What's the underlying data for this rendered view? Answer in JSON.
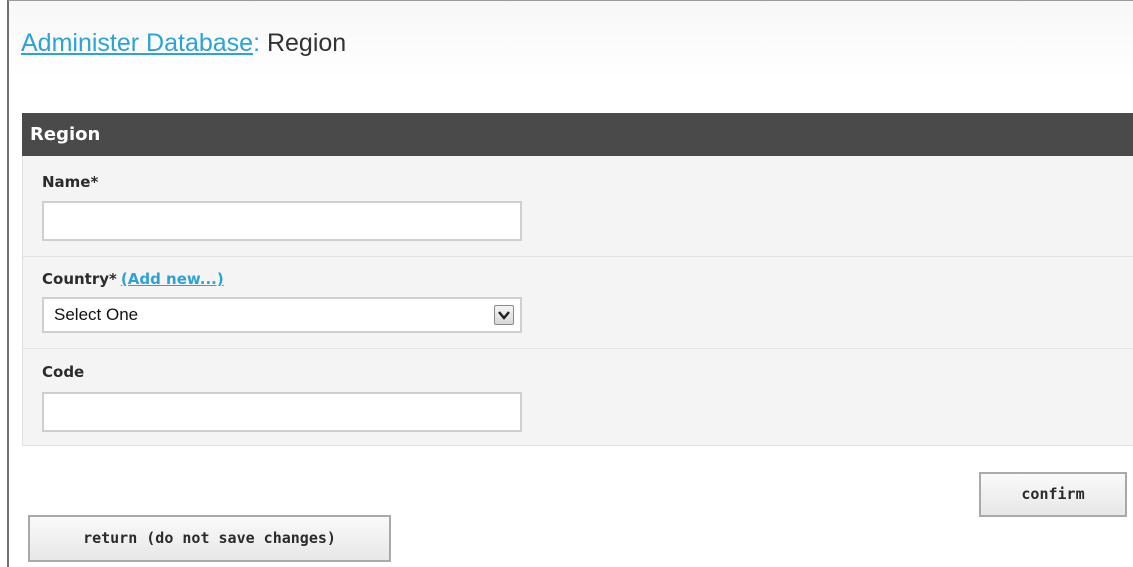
{
  "header": {
    "breadcrumb_link": "Administer Database",
    "separator": ":",
    "current_page": "Region"
  },
  "panel": {
    "title": "Region",
    "fields": {
      "name": {
        "label": "Name*",
        "value": "",
        "placeholder": ""
      },
      "country": {
        "label": "Country*",
        "add_new_label": "(Add new...)",
        "selected": "Select One",
        "arrow_icon": "chevron-down-icon"
      },
      "code": {
        "label": "Code",
        "value": "",
        "placeholder": ""
      }
    }
  },
  "actions": {
    "confirm_label": "confirm",
    "return_label": "return (do not save changes)"
  },
  "colors": {
    "link": "#2ca2d6",
    "panel_header_bg": "#4a4a4a",
    "panel_bg": "#f4f4f4"
  }
}
